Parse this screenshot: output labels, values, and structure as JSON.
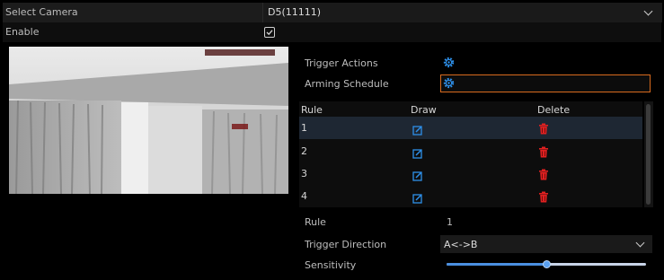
{
  "camera": {
    "label": "Select Camera",
    "value": "D5(11111)"
  },
  "enable": {
    "label": "Enable",
    "checked": true
  },
  "preview": {},
  "actions": {
    "trigger_actions_label": "Trigger Actions",
    "trigger_actions_icon": "gear-icon",
    "arming_schedule_label": "Arming Schedule",
    "arming_schedule_icon": "gear-icon"
  },
  "rule_table": {
    "headers": {
      "rule": "Rule",
      "draw": "Draw",
      "delete": "Delete"
    },
    "rows": [
      {
        "rule": "1",
        "draw_icon": "edit-icon",
        "delete_icon": "trash-icon"
      },
      {
        "rule": "2",
        "draw_icon": "edit-icon",
        "delete_icon": "trash-icon"
      },
      {
        "rule": "3",
        "draw_icon": "edit-icon",
        "delete_icon": "trash-icon"
      },
      {
        "rule": "4",
        "draw_icon": "edit-icon",
        "delete_icon": "trash-icon"
      }
    ]
  },
  "settings": {
    "rule_label": "Rule",
    "rule_value": "1",
    "trigger_direction_label": "Trigger Direction",
    "trigger_direction_value": "A<->B",
    "sensitivity_label": "Sensitivity",
    "sensitivity_fraction": 0.5
  },
  "colors": {
    "accent": "#2e8fe8",
    "schedule_highlight": "#d86a1e",
    "delete": "#e02020",
    "selected_row": "#1e2733"
  }
}
